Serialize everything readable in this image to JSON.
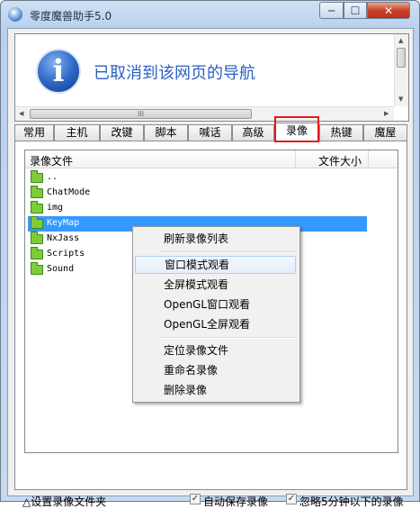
{
  "window": {
    "title": "零度魔兽助手5.0",
    "minimize": "─",
    "maximize": "☐",
    "close": "✕"
  },
  "browser": {
    "info_symbol": "i",
    "message": "已取消到该网页的导航",
    "scroll_thumb_grip": "III"
  },
  "tabs": [
    {
      "label": "常用"
    },
    {
      "label": "主机"
    },
    {
      "label": "改键"
    },
    {
      "label": "脚本"
    },
    {
      "label": "喊话"
    },
    {
      "label": "高级"
    },
    {
      "label": "录像",
      "active": true
    },
    {
      "label": "热键"
    },
    {
      "label": "魔屋"
    }
  ],
  "list": {
    "col_name": "录像文件",
    "col_size": "文件大小",
    "rows": [
      {
        "name": ".."
      },
      {
        "name": "ChatMode"
      },
      {
        "name": "img"
      },
      {
        "name": "KeyMap",
        "selected": true
      },
      {
        "name": "NxJass"
      },
      {
        "name": "Scripts"
      },
      {
        "name": "Sound"
      }
    ]
  },
  "context_menu": [
    {
      "label": "刷新录像列表"
    },
    {
      "label": "窗口模式观看",
      "hover": true
    },
    {
      "label": "全屏模式观看"
    },
    {
      "label": "OpenGL窗口观看"
    },
    {
      "label": "OpenGL全屏观看"
    },
    {
      "label": "定位录像文件"
    },
    {
      "label": "重命名录像"
    },
    {
      "label": "删除录像"
    }
  ],
  "bottom": {
    "set_folder": "△设置录像文件夹",
    "auto_save": {
      "label": "自动保存录像",
      "checked": true
    },
    "ignore_short": {
      "label": "忽略5分钟以下的录像",
      "checked": true
    },
    "check_mark": "✓"
  },
  "colors": {
    "highlight_box": "#e3191d",
    "selection": "#3399ff",
    "folder": "#7ecb3c",
    "message": "#2c5fc3"
  }
}
